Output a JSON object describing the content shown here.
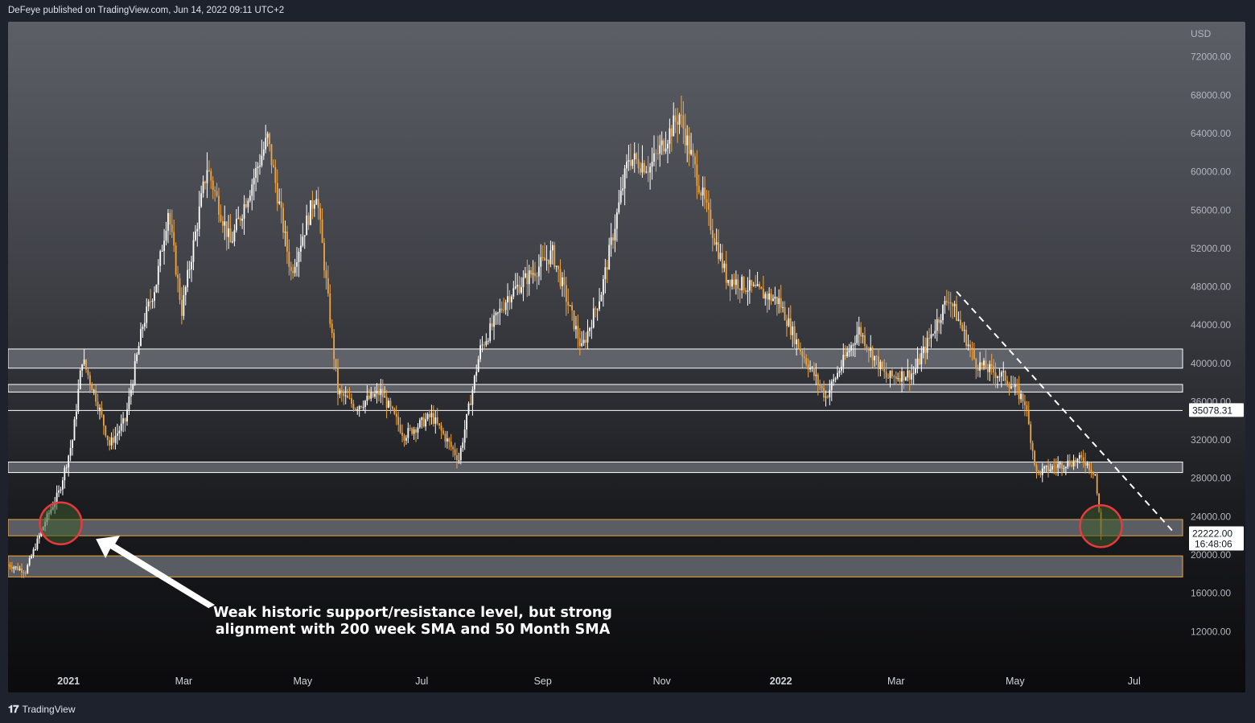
{
  "header": {
    "published": "DeFeye published on TradingView.com, Jun 14, 2022 09:11 UTC+2"
  },
  "footer": {
    "brand": "TradingView",
    "logo_icon": "tradingview-logo-icon"
  },
  "colors": {
    "candle": "#f0a543",
    "bar_dark": "#ffffff",
    "zone_fill": "#6b6e75",
    "zone_white": "#ffffff",
    "zone_orange": "#f0a543",
    "circle": "#e8393d",
    "price_label_bg": "#ffffff",
    "price_label_text": "#131722"
  },
  "chart_data": {
    "type": "candlestick",
    "title": "",
    "currency_label": "USD",
    "y_ticks": [
      12000,
      16000,
      20000,
      24000,
      28000,
      32000,
      36000,
      40000,
      44000,
      48000,
      52000,
      56000,
      60000,
      64000,
      68000,
      72000
    ],
    "y_tick_labels": [
      "12000.00",
      "16000.00",
      "20000.00",
      "24000.00",
      "28000.00",
      "32000.00",
      "36000.00",
      "40000.00",
      "44000.00",
      "48000.00",
      "52000.00",
      "56000.00",
      "60000.00",
      "64000.00",
      "68000.00",
      "72000.00"
    ],
    "ylim": [
      9000,
      75000
    ],
    "x_ticks": [
      {
        "label": "2021",
        "date": "2021-01-01",
        "bold": true
      },
      {
        "label": "Mar",
        "date": "2021-03-01",
        "bold": false
      },
      {
        "label": "May",
        "date": "2021-05-01",
        "bold": false
      },
      {
        "label": "Jul",
        "date": "2021-07-01",
        "bold": false
      },
      {
        "label": "Sep",
        "date": "2021-09-01",
        "bold": false
      },
      {
        "label": "Nov",
        "date": "2021-11-01",
        "bold": false
      },
      {
        "label": "2022",
        "date": "2022-01-01",
        "bold": true
      },
      {
        "label": "Mar",
        "date": "2022-03-01",
        "bold": false
      },
      {
        "label": "May",
        "date": "2022-05-01",
        "bold": false
      },
      {
        "label": "Jul",
        "date": "2022-07-01",
        "bold": false
      }
    ],
    "xlim": [
      "2020-12-01",
      "2022-07-25"
    ],
    "price_path": [
      {
        "date": "2020-12-01",
        "close": 19000
      },
      {
        "date": "2020-12-10",
        "close": 18300
      },
      {
        "date": "2020-12-20",
        "close": 23500
      },
      {
        "date": "2020-12-27",
        "close": 26500
      },
      {
        "date": "2021-01-03",
        "close": 32000
      },
      {
        "date": "2021-01-08",
        "close": 40500
      },
      {
        "date": "2021-01-15",
        "close": 36500
      },
      {
        "date": "2021-01-22",
        "close": 31500
      },
      {
        "date": "2021-01-30",
        "close": 34000
      },
      {
        "date": "2021-02-08",
        "close": 44000
      },
      {
        "date": "2021-02-15",
        "close": 48500
      },
      {
        "date": "2021-02-21",
        "close": 56000
      },
      {
        "date": "2021-02-28",
        "close": 45500
      },
      {
        "date": "2021-03-13",
        "close": 60500
      },
      {
        "date": "2021-03-25",
        "close": 52500
      },
      {
        "date": "2021-04-13",
        "close": 63500
      },
      {
        "date": "2021-04-25",
        "close": 49500
      },
      {
        "date": "2021-05-08",
        "close": 58000
      },
      {
        "date": "2021-05-19",
        "close": 37000
      },
      {
        "date": "2021-05-28",
        "close": 35500
      },
      {
        "date": "2021-06-10",
        "close": 37000
      },
      {
        "date": "2021-06-22",
        "close": 32500
      },
      {
        "date": "2021-07-06",
        "close": 34500
      },
      {
        "date": "2021-07-20",
        "close": 30000
      },
      {
        "date": "2021-07-31",
        "close": 41500
      },
      {
        "date": "2021-08-14",
        "close": 47000
      },
      {
        "date": "2021-09-06",
        "close": 51500
      },
      {
        "date": "2021-09-21",
        "close": 41500
      },
      {
        "date": "2021-10-01",
        "close": 47500
      },
      {
        "date": "2021-10-15",
        "close": 61500
      },
      {
        "date": "2021-10-26",
        "close": 60500
      },
      {
        "date": "2021-11-10",
        "close": 66000
      },
      {
        "date": "2021-11-26",
        "close": 54500
      },
      {
        "date": "2021-12-04",
        "close": 49000
      },
      {
        "date": "2021-12-20",
        "close": 47500
      },
      {
        "date": "2021-12-31",
        "close": 46500
      },
      {
        "date": "2022-01-10",
        "close": 41800
      },
      {
        "date": "2022-01-24",
        "close": 36500
      },
      {
        "date": "2022-02-10",
        "close": 43500
      },
      {
        "date": "2022-02-24",
        "close": 38500
      },
      {
        "date": "2022-03-10",
        "close": 39000
      },
      {
        "date": "2022-03-28",
        "close": 47000
      },
      {
        "date": "2022-04-11",
        "close": 40000
      },
      {
        "date": "2022-04-26",
        "close": 38500
      },
      {
        "date": "2022-05-06",
        "close": 36000
      },
      {
        "date": "2022-05-12",
        "close": 28500
      },
      {
        "date": "2022-05-25",
        "close": 29500
      },
      {
        "date": "2022-06-05",
        "close": 30000
      },
      {
        "date": "2022-06-11",
        "close": 28500
      },
      {
        "date": "2022-06-14",
        "close": 22222
      }
    ],
    "zones": [
      {
        "low": 39500,
        "high": 41500,
        "border": "white"
      },
      {
        "low": 37000,
        "high": 37800,
        "border": "white"
      },
      {
        "line": 35078.31,
        "border": "white"
      },
      {
        "low": 28600,
        "high": 29700,
        "border": "white"
      },
      {
        "low": 22000,
        "high": 23700,
        "border": "orange"
      },
      {
        "low": 17700,
        "high": 19900,
        "border": "orange"
      }
    ],
    "trendline": {
      "start": {
        "date": "2022-04-01",
        "price": 47500
      },
      "end": {
        "date": "2022-07-22",
        "price": 22200
      }
    },
    "circles": [
      {
        "date": "2020-12-28",
        "price": 23300
      },
      {
        "date": "2022-06-14",
        "price": 23000
      }
    ],
    "price_labels": [
      {
        "price": 35078.31,
        "text": "35078.31"
      },
      {
        "price": 22222.0,
        "text": "22222.00",
        "sub": "16:48:06"
      }
    ],
    "annotation": {
      "lines": [
        "Weak historic support/resistance level, but strong",
        "alignment with 200 week SMA and 50 Month SMA"
      ],
      "arrow_icon": "arrow-up-left-icon"
    }
  }
}
